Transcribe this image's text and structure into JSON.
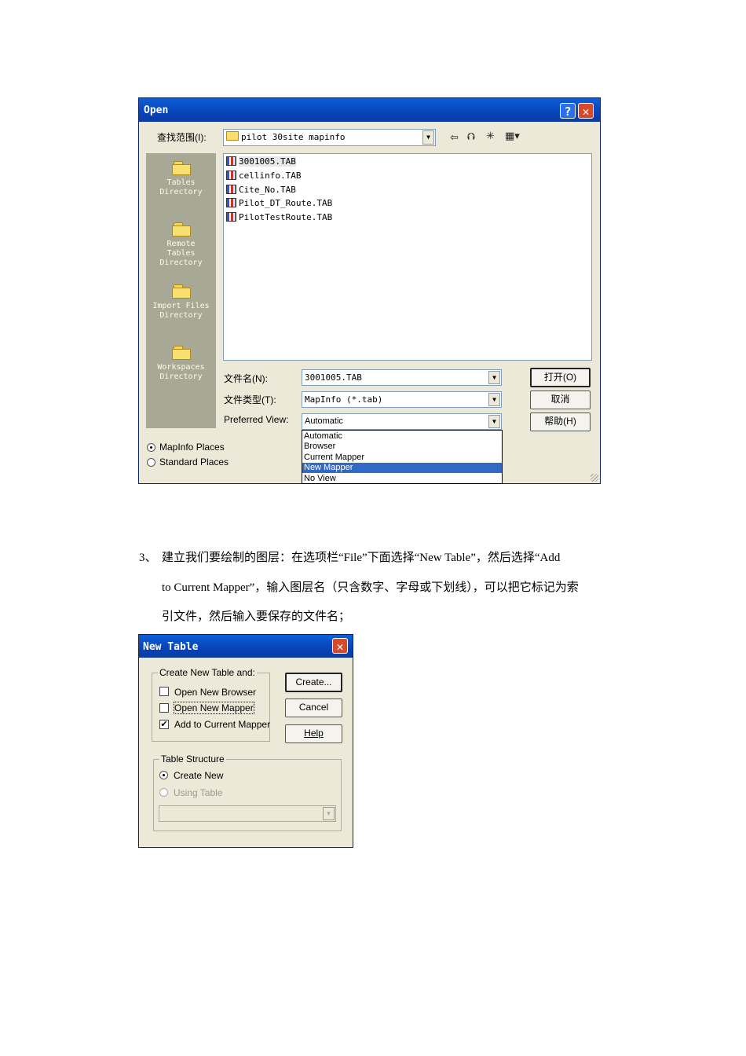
{
  "open_dialog": {
    "title": "Open",
    "look_in_label": "查找范围(I):",
    "look_in_value": "pilot 30site mapinfo",
    "places": [
      {
        "label": "Tables\nDirectory"
      },
      {
        "label": "Remote\nTables\nDirectory"
      },
      {
        "label": "Import Files\nDirectory"
      },
      {
        "label": "Workspaces\nDirectory"
      }
    ],
    "files": [
      "3001005.TAB",
      "cellinfo.TAB",
      "Cite_No.TAB",
      "Pilot_DT_Route.TAB",
      "PilotTestRoute.TAB"
    ],
    "filename_label": "文件名(N):",
    "filename_value": "3001005.TAB",
    "filetype_label": "文件类型(T):",
    "filetype_value": "MapInfo (*.tab)",
    "preferred_view_label": "Preferred View:",
    "preferred_view_value": "Automatic",
    "preferred_view_options": [
      "Automatic",
      "Browser",
      "Current Mapper",
      "New Mapper",
      "No View"
    ],
    "preferred_view_highlighted": "New Mapper",
    "open_button": "打开(O)",
    "cancel_button": "取消",
    "help_button": "帮助(H)",
    "radio_mapinfo_places": "MapInfo Places",
    "radio_standard_places": "Standard Places"
  },
  "paragraph": {
    "number": "3、",
    "line1": "建立我们要绘制的图层：在选项栏“File”下面选择“New Table”，然后选择“Add",
    "line2": "to  Current  Mapper”，输入图层名（只含数字、字母或下划线），可以把它标记为索",
    "line3": "引文件，然后输入要保存的文件名；"
  },
  "new_table_dialog": {
    "title": "New Table",
    "group1_title": "Create New Table and:",
    "opt_open_browser": "Open New Browser",
    "opt_open_mapper": "Open New Mapper",
    "opt_add_current": "Add to Current Mapper",
    "opt_add_current_checked": true,
    "create_button": "Create...",
    "cancel_button": "Cancel",
    "help_button": "Help",
    "group2_title": "Table Structure",
    "radio_create_new": "Create New",
    "radio_using_table": "Using Table"
  }
}
